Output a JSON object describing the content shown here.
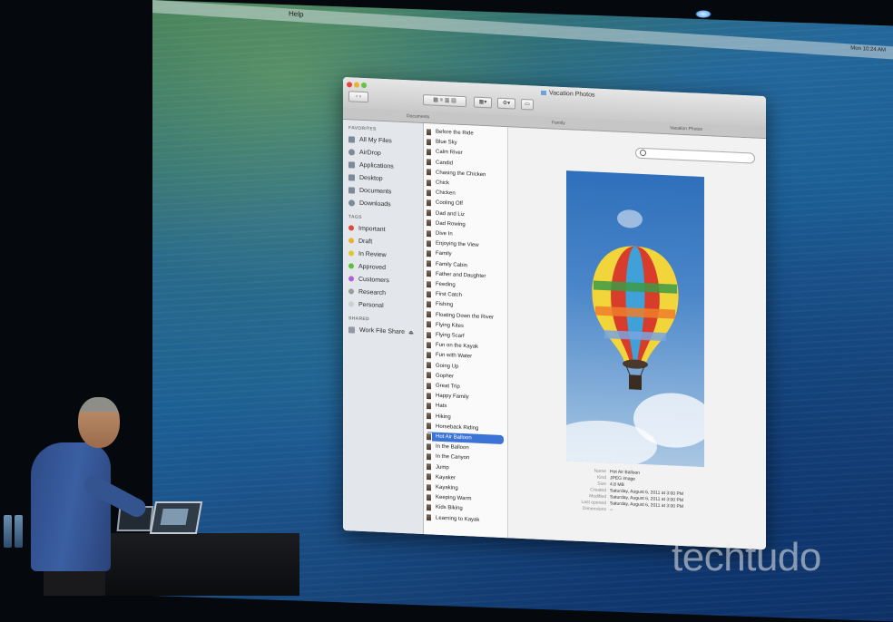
{
  "menubar": {
    "items": [
      "Help"
    ],
    "clock": "Mon 10:24 AM"
  },
  "finder": {
    "title": "Vacation Photos",
    "tabs": [
      "Documents",
      "Family",
      "Vacation Photos"
    ],
    "sidebar": {
      "favorites_header": "FAVORITES",
      "favorites": [
        {
          "label": "All My Files",
          "icon": "all-files-icon"
        },
        {
          "label": "AirDrop",
          "icon": "airdrop-icon"
        },
        {
          "label": "Applications",
          "icon": "applications-icon"
        },
        {
          "label": "Desktop",
          "icon": "desktop-icon"
        },
        {
          "label": "Documents",
          "icon": "documents-icon"
        },
        {
          "label": "Downloads",
          "icon": "downloads-icon"
        }
      ],
      "tags_header": "TAGS",
      "tags": [
        {
          "label": "Important",
          "color": "#e2463f"
        },
        {
          "label": "Draft",
          "color": "#e9b12e"
        },
        {
          "label": "In Review",
          "color": "#e3c52d"
        },
        {
          "label": "Approved",
          "color": "#5bbf3d"
        },
        {
          "label": "Customers",
          "color": "#b35fd6"
        },
        {
          "label": "Research",
          "color": "#9a9a9a"
        },
        {
          "label": "Personal",
          "color": "#cfcfcf"
        }
      ],
      "shared_header": "SHARED",
      "shared": [
        {
          "label": "Work File Share",
          "icon": "server-icon"
        }
      ]
    },
    "files": [
      "Before the Ride",
      "Blue Sky",
      "Calm River",
      "Candid",
      "Chasing the Chicken",
      "Chick",
      "Chicken",
      "Cooling Off",
      "Dad and Liz",
      "Dad Rowing",
      "Dive In",
      "Enjoying the View",
      "Family",
      "Family Cabin",
      "Father and Daughter",
      "Feeding",
      "First Catch",
      "Fishing",
      "Floating Down the River",
      "Flying Kites",
      "Flying Scarf",
      "Fun on the Kayak",
      "Fun with Water",
      "Going Up",
      "Gopher",
      "Great Trip",
      "Happy Family",
      "Hats",
      "Hiking",
      "Horseback Riding",
      "Hot Air Balloon",
      "In the Balloon",
      "In the Canyon",
      "Jump",
      "Kayaker",
      "Kayaking",
      "Keeping Warm",
      "Kids Biking",
      "Learning to Kayak"
    ],
    "selected_file": "Hot Air Balloon",
    "preview_info": [
      {
        "k": "Name",
        "v": "Hot Air Balloon"
      },
      {
        "k": "Kind",
        "v": "JPEG image"
      },
      {
        "k": "Size",
        "v": "4.8 MB"
      },
      {
        "k": "Created",
        "v": "Saturday, August 6, 2011 at 3:00 PM"
      },
      {
        "k": "Modified",
        "v": "Saturday, August 6, 2011 at 3:00 PM"
      },
      {
        "k": "Last opened",
        "v": "Saturday, August 6, 2011 at 3:00 PM"
      },
      {
        "k": "Dimensions",
        "v": "--"
      }
    ]
  },
  "watermark": "techtudo"
}
